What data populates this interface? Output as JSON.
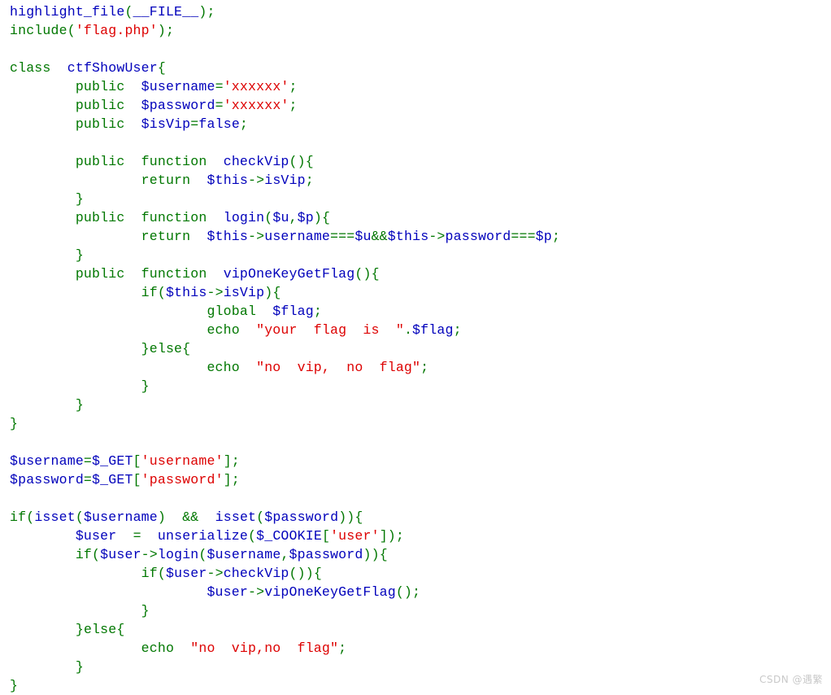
{
  "document": {
    "kind": "php-highlight-file-output",
    "background_color": "#ffffff",
    "first_line_clipped": true
  },
  "colors": {
    "keyword_green": "#007700",
    "variable_blue": "#0000BB",
    "string_red": "#DD0000",
    "default_blue": "#0000BB",
    "comment_orange": "#FF8000",
    "watermark_gray": "#c9c9c9"
  },
  "watermark": {
    "text": "CSDN @遇繁"
  },
  "code": {
    "language": "PHP",
    "plain_text": "highlight_file(__FILE__);\ninclude('flag.php');\n\nclass ctfShowUser{\n\tpublic $username='xxxxxx';\n\tpublic $password='xxxxxx';\n\tpublic $isVip=false;\n\n\tpublic function checkVip(){\n\t\treturn $this->isVip;\n\t}\n\tpublic function login($u,$p){\n\t\treturn $this->username===$u&&$this->password===$p;\n\t}\n\tpublic function vipOneKeyGetFlag(){\n\t\tif($this->isVip){\n\t\t\tglobal $flag;\n\t\t\techo \"your flag is \".$flag;\n\t\t}else{\n\t\t\techo \"no vip, no flag\";\n\t\t}\n\t}\n}\n\n$username=$_GET['username'];\n$password=$_GET['password'];\n\nif(isset($username) && isset($password)){\n\t$user = unserialize($_COOKIE['user']);\n\tif($user->login($username,$password)){\n\t\tif($user->checkVip()){\n\t\t\t$user->vipOneKeyGetFlag();\n\t\t}\n\t}else{\n\t\techo \"no vip,no flag\";\n\t}\n}",
    "lines": [
      {
        "n": 1,
        "clipped": true,
        "tokens": [
          {
            "t": "highlight_file",
            "c": "var"
          },
          {
            "t": "(",
            "c": "kw"
          },
          {
            "t": "__FILE__",
            "c": "var"
          },
          {
            "t": ")",
            "c": "kw"
          },
          {
            "t": ";",
            "c": "kw"
          }
        ]
      },
      {
        "n": 2,
        "tokens": [
          {
            "t": "include",
            "c": "kw"
          },
          {
            "t": "(",
            "c": "kw"
          },
          {
            "t": "'flag.php'",
            "c": "str"
          },
          {
            "t": ")",
            "c": "kw"
          },
          {
            "t": ";",
            "c": "kw"
          }
        ]
      },
      {
        "n": 3,
        "tokens": []
      },
      {
        "n": 4,
        "tokens": [
          {
            "t": "class",
            "c": "kw"
          },
          {
            "t": "  ",
            "c": "plain"
          },
          {
            "t": "ctfShowUser",
            "c": "var"
          },
          {
            "t": "{",
            "c": "kw"
          }
        ]
      },
      {
        "n": 5,
        "tokens": [
          {
            "t": "        ",
            "c": "plain"
          },
          {
            "t": "public",
            "c": "kw"
          },
          {
            "t": "  ",
            "c": "plain"
          },
          {
            "t": "$username",
            "c": "var"
          },
          {
            "t": "=",
            "c": "kw"
          },
          {
            "t": "'xxxxxx'",
            "c": "str"
          },
          {
            "t": ";",
            "c": "kw"
          }
        ]
      },
      {
        "n": 6,
        "tokens": [
          {
            "t": "        ",
            "c": "plain"
          },
          {
            "t": "public",
            "c": "kw"
          },
          {
            "t": "  ",
            "c": "plain"
          },
          {
            "t": "$password",
            "c": "var"
          },
          {
            "t": "=",
            "c": "kw"
          },
          {
            "t": "'xxxxxx'",
            "c": "str"
          },
          {
            "t": ";",
            "c": "kw"
          }
        ]
      },
      {
        "n": 7,
        "tokens": [
          {
            "t": "        ",
            "c": "plain"
          },
          {
            "t": "public",
            "c": "kw"
          },
          {
            "t": "  ",
            "c": "plain"
          },
          {
            "t": "$isVip",
            "c": "var"
          },
          {
            "t": "=",
            "c": "kw"
          },
          {
            "t": "false",
            "c": "var"
          },
          {
            "t": ";",
            "c": "kw"
          }
        ]
      },
      {
        "n": 8,
        "tokens": []
      },
      {
        "n": 9,
        "tokens": [
          {
            "t": "        ",
            "c": "plain"
          },
          {
            "t": "public",
            "c": "kw"
          },
          {
            "t": "  ",
            "c": "plain"
          },
          {
            "t": "function",
            "c": "kw"
          },
          {
            "t": "  ",
            "c": "plain"
          },
          {
            "t": "checkVip",
            "c": "var"
          },
          {
            "t": "()",
            "c": "kw"
          },
          {
            "t": "{",
            "c": "kw"
          }
        ]
      },
      {
        "n": 10,
        "tokens": [
          {
            "t": "                ",
            "c": "plain"
          },
          {
            "t": "return",
            "c": "kw"
          },
          {
            "t": "  ",
            "c": "plain"
          },
          {
            "t": "$this",
            "c": "var"
          },
          {
            "t": "->",
            "c": "kw"
          },
          {
            "t": "isVip",
            "c": "var"
          },
          {
            "t": ";",
            "c": "kw"
          }
        ]
      },
      {
        "n": 11,
        "tokens": [
          {
            "t": "        ",
            "c": "plain"
          },
          {
            "t": "}",
            "c": "kw"
          }
        ]
      },
      {
        "n": 12,
        "tokens": [
          {
            "t": "        ",
            "c": "plain"
          },
          {
            "t": "public",
            "c": "kw"
          },
          {
            "t": "  ",
            "c": "plain"
          },
          {
            "t": "function",
            "c": "kw"
          },
          {
            "t": "  ",
            "c": "plain"
          },
          {
            "t": "login",
            "c": "var"
          },
          {
            "t": "(",
            "c": "kw"
          },
          {
            "t": "$u",
            "c": "var"
          },
          {
            "t": ",",
            "c": "kw"
          },
          {
            "t": "$p",
            "c": "var"
          },
          {
            "t": ")",
            "c": "kw"
          },
          {
            "t": "{",
            "c": "kw"
          }
        ]
      },
      {
        "n": 13,
        "tokens": [
          {
            "t": "                ",
            "c": "plain"
          },
          {
            "t": "return",
            "c": "kw"
          },
          {
            "t": "  ",
            "c": "plain"
          },
          {
            "t": "$this",
            "c": "var"
          },
          {
            "t": "->",
            "c": "kw"
          },
          {
            "t": "username",
            "c": "var"
          },
          {
            "t": "===",
            "c": "kw"
          },
          {
            "t": "$u",
            "c": "var"
          },
          {
            "t": "&&",
            "c": "kw"
          },
          {
            "t": "$this",
            "c": "var"
          },
          {
            "t": "->",
            "c": "kw"
          },
          {
            "t": "password",
            "c": "var"
          },
          {
            "t": "===",
            "c": "kw"
          },
          {
            "t": "$p",
            "c": "var"
          },
          {
            "t": ";",
            "c": "kw"
          }
        ]
      },
      {
        "n": 14,
        "tokens": [
          {
            "t": "        ",
            "c": "plain"
          },
          {
            "t": "}",
            "c": "kw"
          }
        ]
      },
      {
        "n": 15,
        "tokens": [
          {
            "t": "        ",
            "c": "plain"
          },
          {
            "t": "public",
            "c": "kw"
          },
          {
            "t": "  ",
            "c": "plain"
          },
          {
            "t": "function",
            "c": "kw"
          },
          {
            "t": "  ",
            "c": "plain"
          },
          {
            "t": "vipOneKeyGetFlag",
            "c": "var"
          },
          {
            "t": "()",
            "c": "kw"
          },
          {
            "t": "{",
            "c": "kw"
          }
        ]
      },
      {
        "n": 16,
        "tokens": [
          {
            "t": "                ",
            "c": "plain"
          },
          {
            "t": "if",
            "c": "kw"
          },
          {
            "t": "(",
            "c": "kw"
          },
          {
            "t": "$this",
            "c": "var"
          },
          {
            "t": "->",
            "c": "kw"
          },
          {
            "t": "isVip",
            "c": "var"
          },
          {
            "t": ")",
            "c": "kw"
          },
          {
            "t": "{",
            "c": "kw"
          }
        ]
      },
      {
        "n": 17,
        "tokens": [
          {
            "t": "                        ",
            "c": "plain"
          },
          {
            "t": "global",
            "c": "kw"
          },
          {
            "t": "  ",
            "c": "plain"
          },
          {
            "t": "$flag",
            "c": "var"
          },
          {
            "t": ";",
            "c": "kw"
          }
        ]
      },
      {
        "n": 18,
        "tokens": [
          {
            "t": "                        ",
            "c": "plain"
          },
          {
            "t": "echo",
            "c": "kw"
          },
          {
            "t": "  ",
            "c": "plain"
          },
          {
            "t": "\"your  flag  is  \"",
            "c": "str"
          },
          {
            "t": ".",
            "c": "kw"
          },
          {
            "t": "$flag",
            "c": "var"
          },
          {
            "t": ";",
            "c": "kw"
          }
        ]
      },
      {
        "n": 19,
        "tokens": [
          {
            "t": "                ",
            "c": "plain"
          },
          {
            "t": "}",
            "c": "kw"
          },
          {
            "t": "else",
            "c": "kw"
          },
          {
            "t": "{",
            "c": "kw"
          }
        ]
      },
      {
        "n": 20,
        "tokens": [
          {
            "t": "                        ",
            "c": "plain"
          },
          {
            "t": "echo",
            "c": "kw"
          },
          {
            "t": "  ",
            "c": "plain"
          },
          {
            "t": "\"no  vip,  no  flag\"",
            "c": "str"
          },
          {
            "t": ";",
            "c": "kw"
          }
        ]
      },
      {
        "n": 21,
        "tokens": [
          {
            "t": "                ",
            "c": "plain"
          },
          {
            "t": "}",
            "c": "kw"
          }
        ]
      },
      {
        "n": 22,
        "tokens": [
          {
            "t": "        ",
            "c": "plain"
          },
          {
            "t": "}",
            "c": "kw"
          }
        ]
      },
      {
        "n": 23,
        "tokens": [
          {
            "t": "}",
            "c": "kw"
          }
        ]
      },
      {
        "n": 24,
        "tokens": []
      },
      {
        "n": 25,
        "tokens": [
          {
            "t": "$username",
            "c": "var"
          },
          {
            "t": "=",
            "c": "kw"
          },
          {
            "t": "$_GET",
            "c": "var"
          },
          {
            "t": "[",
            "c": "kw"
          },
          {
            "t": "'username'",
            "c": "str"
          },
          {
            "t": "]",
            "c": "kw"
          },
          {
            "t": ";",
            "c": "kw"
          }
        ]
      },
      {
        "n": 26,
        "tokens": [
          {
            "t": "$password",
            "c": "var"
          },
          {
            "t": "=",
            "c": "kw"
          },
          {
            "t": "$_GET",
            "c": "var"
          },
          {
            "t": "[",
            "c": "kw"
          },
          {
            "t": "'password'",
            "c": "str"
          },
          {
            "t": "]",
            "c": "kw"
          },
          {
            "t": ";",
            "c": "kw"
          }
        ]
      },
      {
        "n": 27,
        "tokens": []
      },
      {
        "n": 28,
        "tokens": [
          {
            "t": "if",
            "c": "kw"
          },
          {
            "t": "(",
            "c": "kw"
          },
          {
            "t": "isset",
            "c": "var"
          },
          {
            "t": "(",
            "c": "kw"
          },
          {
            "t": "$username",
            "c": "var"
          },
          {
            "t": ")",
            "c": "kw"
          },
          {
            "t": "  ",
            "c": "plain"
          },
          {
            "t": "&&",
            "c": "kw"
          },
          {
            "t": "  ",
            "c": "plain"
          },
          {
            "t": "isset",
            "c": "var"
          },
          {
            "t": "(",
            "c": "kw"
          },
          {
            "t": "$password",
            "c": "var"
          },
          {
            "t": "))",
            "c": "kw"
          },
          {
            "t": "{",
            "c": "kw"
          }
        ]
      },
      {
        "n": 29,
        "tokens": [
          {
            "t": "        ",
            "c": "plain"
          },
          {
            "t": "$user",
            "c": "var"
          },
          {
            "t": "  ",
            "c": "plain"
          },
          {
            "t": "=",
            "c": "kw"
          },
          {
            "t": "  ",
            "c": "plain"
          },
          {
            "t": "unserialize",
            "c": "var"
          },
          {
            "t": "(",
            "c": "kw"
          },
          {
            "t": "$_COOKIE",
            "c": "var"
          },
          {
            "t": "[",
            "c": "kw"
          },
          {
            "t": "'user'",
            "c": "str"
          },
          {
            "t": "]",
            "c": "kw"
          },
          {
            "t": ")",
            "c": "kw"
          },
          {
            "t": ";",
            "c": "kw"
          }
        ]
      },
      {
        "n": 30,
        "tokens": [
          {
            "t": "        ",
            "c": "plain"
          },
          {
            "t": "if",
            "c": "kw"
          },
          {
            "t": "(",
            "c": "kw"
          },
          {
            "t": "$user",
            "c": "var"
          },
          {
            "t": "->",
            "c": "kw"
          },
          {
            "t": "login",
            "c": "var"
          },
          {
            "t": "(",
            "c": "kw"
          },
          {
            "t": "$username",
            "c": "var"
          },
          {
            "t": ",",
            "c": "kw"
          },
          {
            "t": "$password",
            "c": "var"
          },
          {
            "t": "))",
            "c": "kw"
          },
          {
            "t": "{",
            "c": "kw"
          }
        ]
      },
      {
        "n": 31,
        "tokens": [
          {
            "t": "                ",
            "c": "plain"
          },
          {
            "t": "if",
            "c": "kw"
          },
          {
            "t": "(",
            "c": "kw"
          },
          {
            "t": "$user",
            "c": "var"
          },
          {
            "t": "->",
            "c": "kw"
          },
          {
            "t": "checkVip",
            "c": "var"
          },
          {
            "t": "())",
            "c": "kw"
          },
          {
            "t": "{",
            "c": "kw"
          }
        ]
      },
      {
        "n": 32,
        "tokens": [
          {
            "t": "                        ",
            "c": "plain"
          },
          {
            "t": "$user",
            "c": "var"
          },
          {
            "t": "->",
            "c": "kw"
          },
          {
            "t": "vipOneKeyGetFlag",
            "c": "var"
          },
          {
            "t": "()",
            "c": "kw"
          },
          {
            "t": ";",
            "c": "kw"
          }
        ]
      },
      {
        "n": 33,
        "tokens": [
          {
            "t": "                ",
            "c": "plain"
          },
          {
            "t": "}",
            "c": "kw"
          }
        ]
      },
      {
        "n": 34,
        "tokens": [
          {
            "t": "        ",
            "c": "plain"
          },
          {
            "t": "}",
            "c": "kw"
          },
          {
            "t": "else",
            "c": "kw"
          },
          {
            "t": "{",
            "c": "kw"
          }
        ]
      },
      {
        "n": 35,
        "tokens": [
          {
            "t": "                ",
            "c": "plain"
          },
          {
            "t": "echo",
            "c": "kw"
          },
          {
            "t": "  ",
            "c": "plain"
          },
          {
            "t": "\"no  vip,no  flag\"",
            "c": "str"
          },
          {
            "t": ";",
            "c": "kw"
          }
        ]
      },
      {
        "n": 36,
        "tokens": [
          {
            "t": "        ",
            "c": "plain"
          },
          {
            "t": "}",
            "c": "kw"
          }
        ]
      },
      {
        "n": 37,
        "tokens": [
          {
            "t": "}",
            "c": "kw"
          }
        ]
      }
    ]
  }
}
